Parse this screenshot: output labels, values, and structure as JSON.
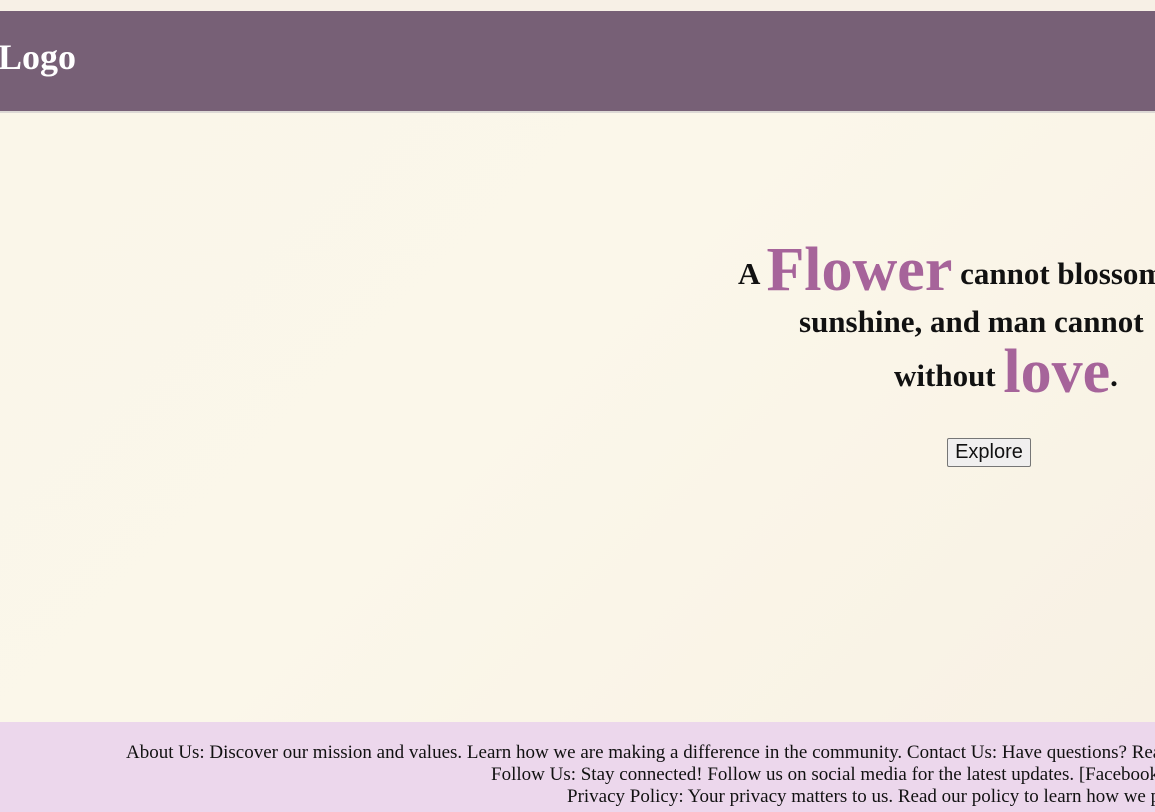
{
  "header": {
    "logo_text": "Logo"
  },
  "hero": {
    "quote": {
      "part1_prefix": "A ",
      "part1_accent": "Flower",
      "part1_suffix": " cannot blossom",
      "part2": "sunshine, and man cannot",
      "part3_prefix": "without ",
      "part3_accent": "love",
      "part3_suffix": "."
    },
    "explore_label": "Explore"
  },
  "footer": {
    "about_line": "About Us: Discover our mission and values. Learn how we are making a difference in the community. Contact Us: Have questions? Rea",
    "follow_line": "Follow Us: Stay connected! Follow us on social media for the latest updates. [Facebook",
    "privacy_line": "Privacy Policy: Your privacy matters to us. Read our policy to learn how we p"
  },
  "colors": {
    "header_bg": "#776076",
    "accent": "#a6649a",
    "footer_bg": "#ecd7ec",
    "hero_bg": "#f9f4e7"
  }
}
